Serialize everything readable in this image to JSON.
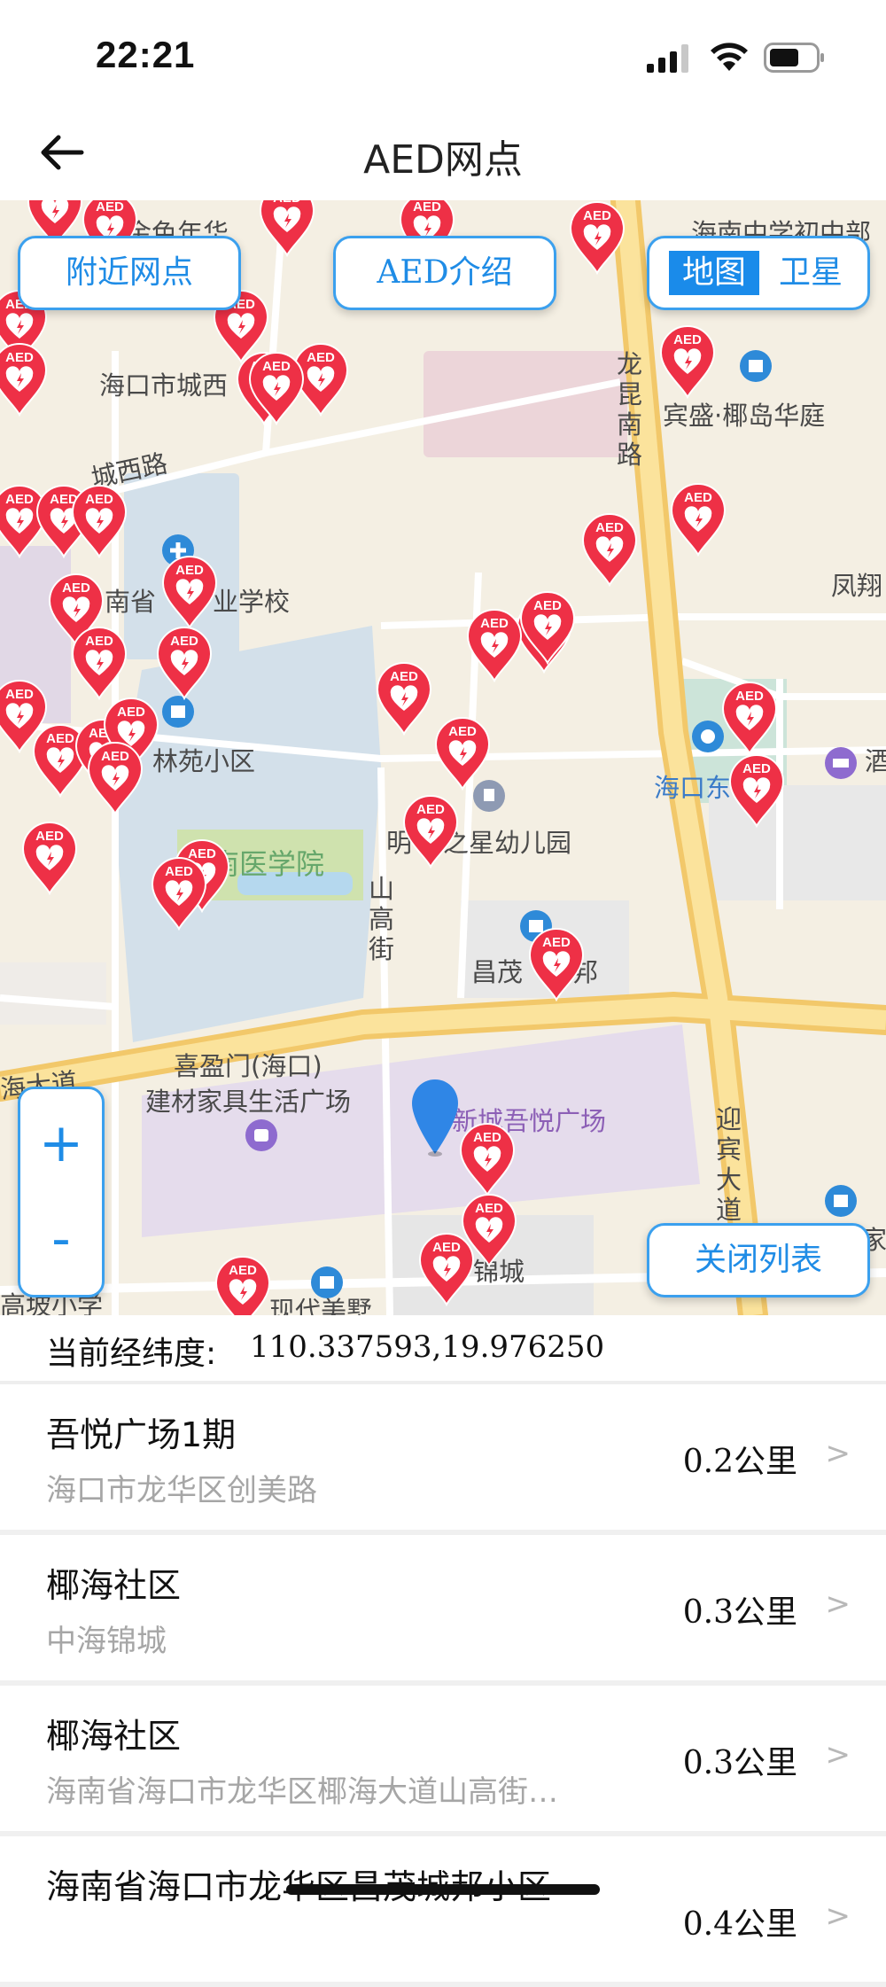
{
  "status_bar": {
    "time": "22:21"
  },
  "nav": {
    "title": "AED网点"
  },
  "map": {
    "buttons": {
      "nearby": "附近网点",
      "aed_intro": "AED介绍",
      "map_type_map": "地图",
      "map_type_satellite": "卫星",
      "zoom_in": "+",
      "zoom_out": "-",
      "close_list": "关闭列表"
    },
    "marker_label": "AED",
    "labels": {
      "l1": "海口市城西",
      "l2": "城西路",
      "l3": "南省",
      "l3b": "业学校",
      "l4": "林苑小区",
      "l5": "海南医学院",
      "l6": "明",
      "l6b": "之星幼儿园",
      "l7": "昌茂",
      "l7b": "邦",
      "l8": "喜盈门(海口)",
      "l9": "建材家具生活广场",
      "l10": "新城吾悦广场",
      "l11": "宾盛·椰岛华庭",
      "l12": "凤翔",
      "l13": "海口东",
      "l14": "龙昆南路",
      "l15": "山高街",
      "l16": "迎宾大道",
      "l17": "海大道",
      "l18": "高坡小学",
      "l19": "锦城",
      "l20": "海南中学初中部",
      "l21": "金色年华",
      "l22": "现代美墅",
      "l23": "家",
      "l24": "酒"
    },
    "colors": {
      "marker": "#ee3046",
      "button_border": "#3ba0ee",
      "button_text": "#1f8ce6",
      "road": "#f5cf6b"
    }
  },
  "coords": {
    "label": "当前经纬度:",
    "value": "110.337593,19.976250"
  },
  "list": [
    {
      "name": "吾悦广场1期",
      "address": "海口市龙华区创美路",
      "distance": "0.2公里"
    },
    {
      "name": "椰海社区",
      "address": "中海锦城",
      "distance": "0.3公里"
    },
    {
      "name": "椰海社区",
      "address": "海南省海口市龙华区椰海大道山高街…",
      "distance": "0.3公里"
    },
    {
      "name": "海南省海口市龙华区昌茂城邦小区",
      "address": "",
      "distance": "0.4公里"
    }
  ],
  "chevron": ">"
}
